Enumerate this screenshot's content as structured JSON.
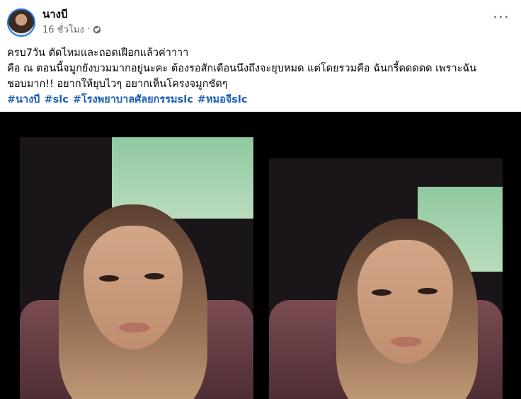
{
  "post": {
    "author": "นางบี",
    "time": "16 ชั่วโมง",
    "dot": "·",
    "more": "···",
    "caption_lines": [
      "ครบ7วัน ตัดไหมและถอดเฝือกแล้วค่าาาา",
      "คือ ณ ตอนนี้จมูกยังบวมมากอยู่นะคะ ต้องรอสักเดือนนึงถึงจะยุบหมด แต่โดยรวมคือ ฉันกรี้ดดดดด เพราะฉัน",
      "ชอบมาก!! อยากให้ยุบไวๆ อยากเห็นโครงจมูกชัดๆ"
    ],
    "hashtags": [
      "#นางบี",
      "#slc",
      "#โรงพยาบาลศัลยกรรมslc",
      "#หมอจีslc"
    ]
  },
  "colors": {
    "link": "#1a5fb4",
    "secondary_text": "#65676b",
    "media_background": "#000000"
  },
  "icons": [
    "globe-icon",
    "more-options-icon"
  ]
}
